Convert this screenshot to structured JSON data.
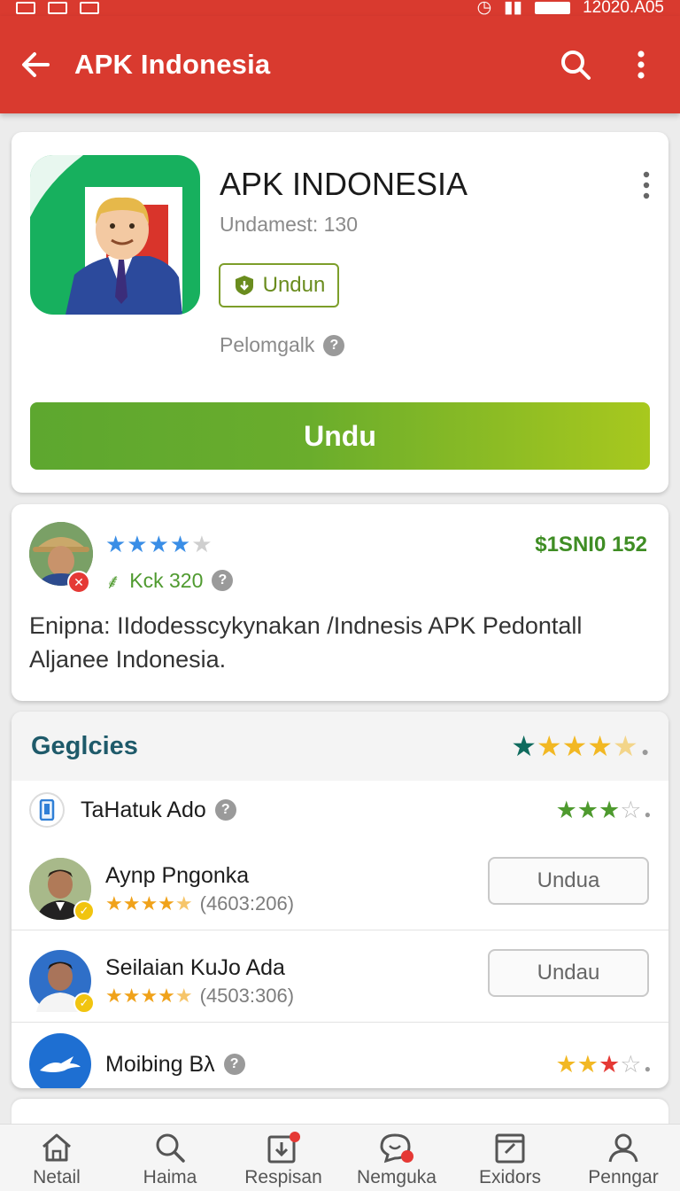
{
  "status_bar": {
    "time": "12020.A05"
  },
  "app_bar": {
    "title": "APK Indonesia",
    "back_icon": "arrow-left-icon",
    "search_icon": "search-icon",
    "menu_icon": "more-vert-icon",
    "color": "#d93a2f"
  },
  "app_card": {
    "name": "APK INDONESIA",
    "subtitle": "Undamest: 130",
    "badge_label": "Undun",
    "info_label": "Pelomgalk",
    "install_label": "Undu",
    "accent": "#6aad2c"
  },
  "review": {
    "stars": 4,
    "price": "$1SNI0 152",
    "meta": "Kck 320",
    "text": "Enipna: IIdodesscykynakan /Indnesis APK Pedontall Aljanee Indonesia."
  },
  "list": {
    "heading": "Geglcies",
    "heading_rating": 4,
    "items": [
      {
        "title": "TaHatuk Ado",
        "rating": 3,
        "icon": "phone-icon"
      },
      {
        "title": "Aynp Pngonka",
        "count": "(4603:206)",
        "rating": 4.5,
        "button": "Undua"
      },
      {
        "title": "Seilaian KuJo Ada",
        "count": "(4503:306)",
        "rating": 4.5,
        "button": "Undau"
      },
      {
        "title": "Moibing Bλ",
        "rating": 3,
        "icon": "bird-icon"
      }
    ]
  },
  "bottom_nav": [
    {
      "label": "Netail",
      "icon": "home-icon"
    },
    {
      "label": "Haima",
      "icon": "search-icon"
    },
    {
      "label": "Respisan",
      "icon": "download-icon"
    },
    {
      "label": "Nemguka",
      "icon": "chat-icon"
    },
    {
      "label": "Exidors",
      "icon": "edit-box-icon"
    },
    {
      "label": "Penngar",
      "icon": "person-icon"
    }
  ]
}
